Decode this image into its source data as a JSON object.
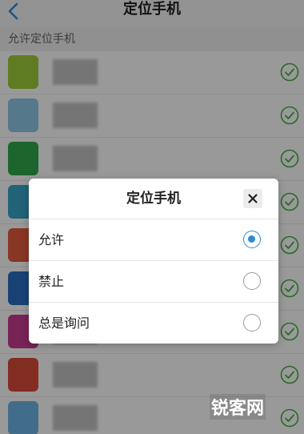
{
  "header": {
    "title": "定位手机",
    "back_icon": "chevron-left-icon"
  },
  "section": {
    "label": "允许定位手机"
  },
  "app_list": {
    "check_icon": "circle-check-icon",
    "check_color": "#3db53d",
    "items": [
      {
        "label": "",
        "icon_color": "#9fcf3a",
        "checked": true
      },
      {
        "label": "",
        "icon_color": "#8ec8e8",
        "checked": true
      },
      {
        "label": "",
        "icon_color": "#2fa84a",
        "checked": true
      },
      {
        "label": "",
        "icon_color": "#3aa6c8",
        "checked": true
      },
      {
        "label": "",
        "icon_color": "#e45a3e",
        "checked": true
      },
      {
        "label": "",
        "icon_color": "#2a6fc2",
        "checked": true
      },
      {
        "label": "",
        "icon_color": "#c93b8f",
        "checked": true
      },
      {
        "label": "",
        "icon_color": "#d94a3a",
        "checked": true
      },
      {
        "label": "",
        "icon_color": "#6fb6e6",
        "checked": true
      }
    ]
  },
  "dialog": {
    "title": "定位手机",
    "close_icon": "close-icon",
    "options": [
      {
        "label": "允许",
        "selected": true
      },
      {
        "label": "禁止",
        "selected": false
      },
      {
        "label": "总是询问",
        "selected": false
      }
    ],
    "accent_color": "#2b8bd8"
  },
  "watermark": {
    "text": "锐客网"
  }
}
